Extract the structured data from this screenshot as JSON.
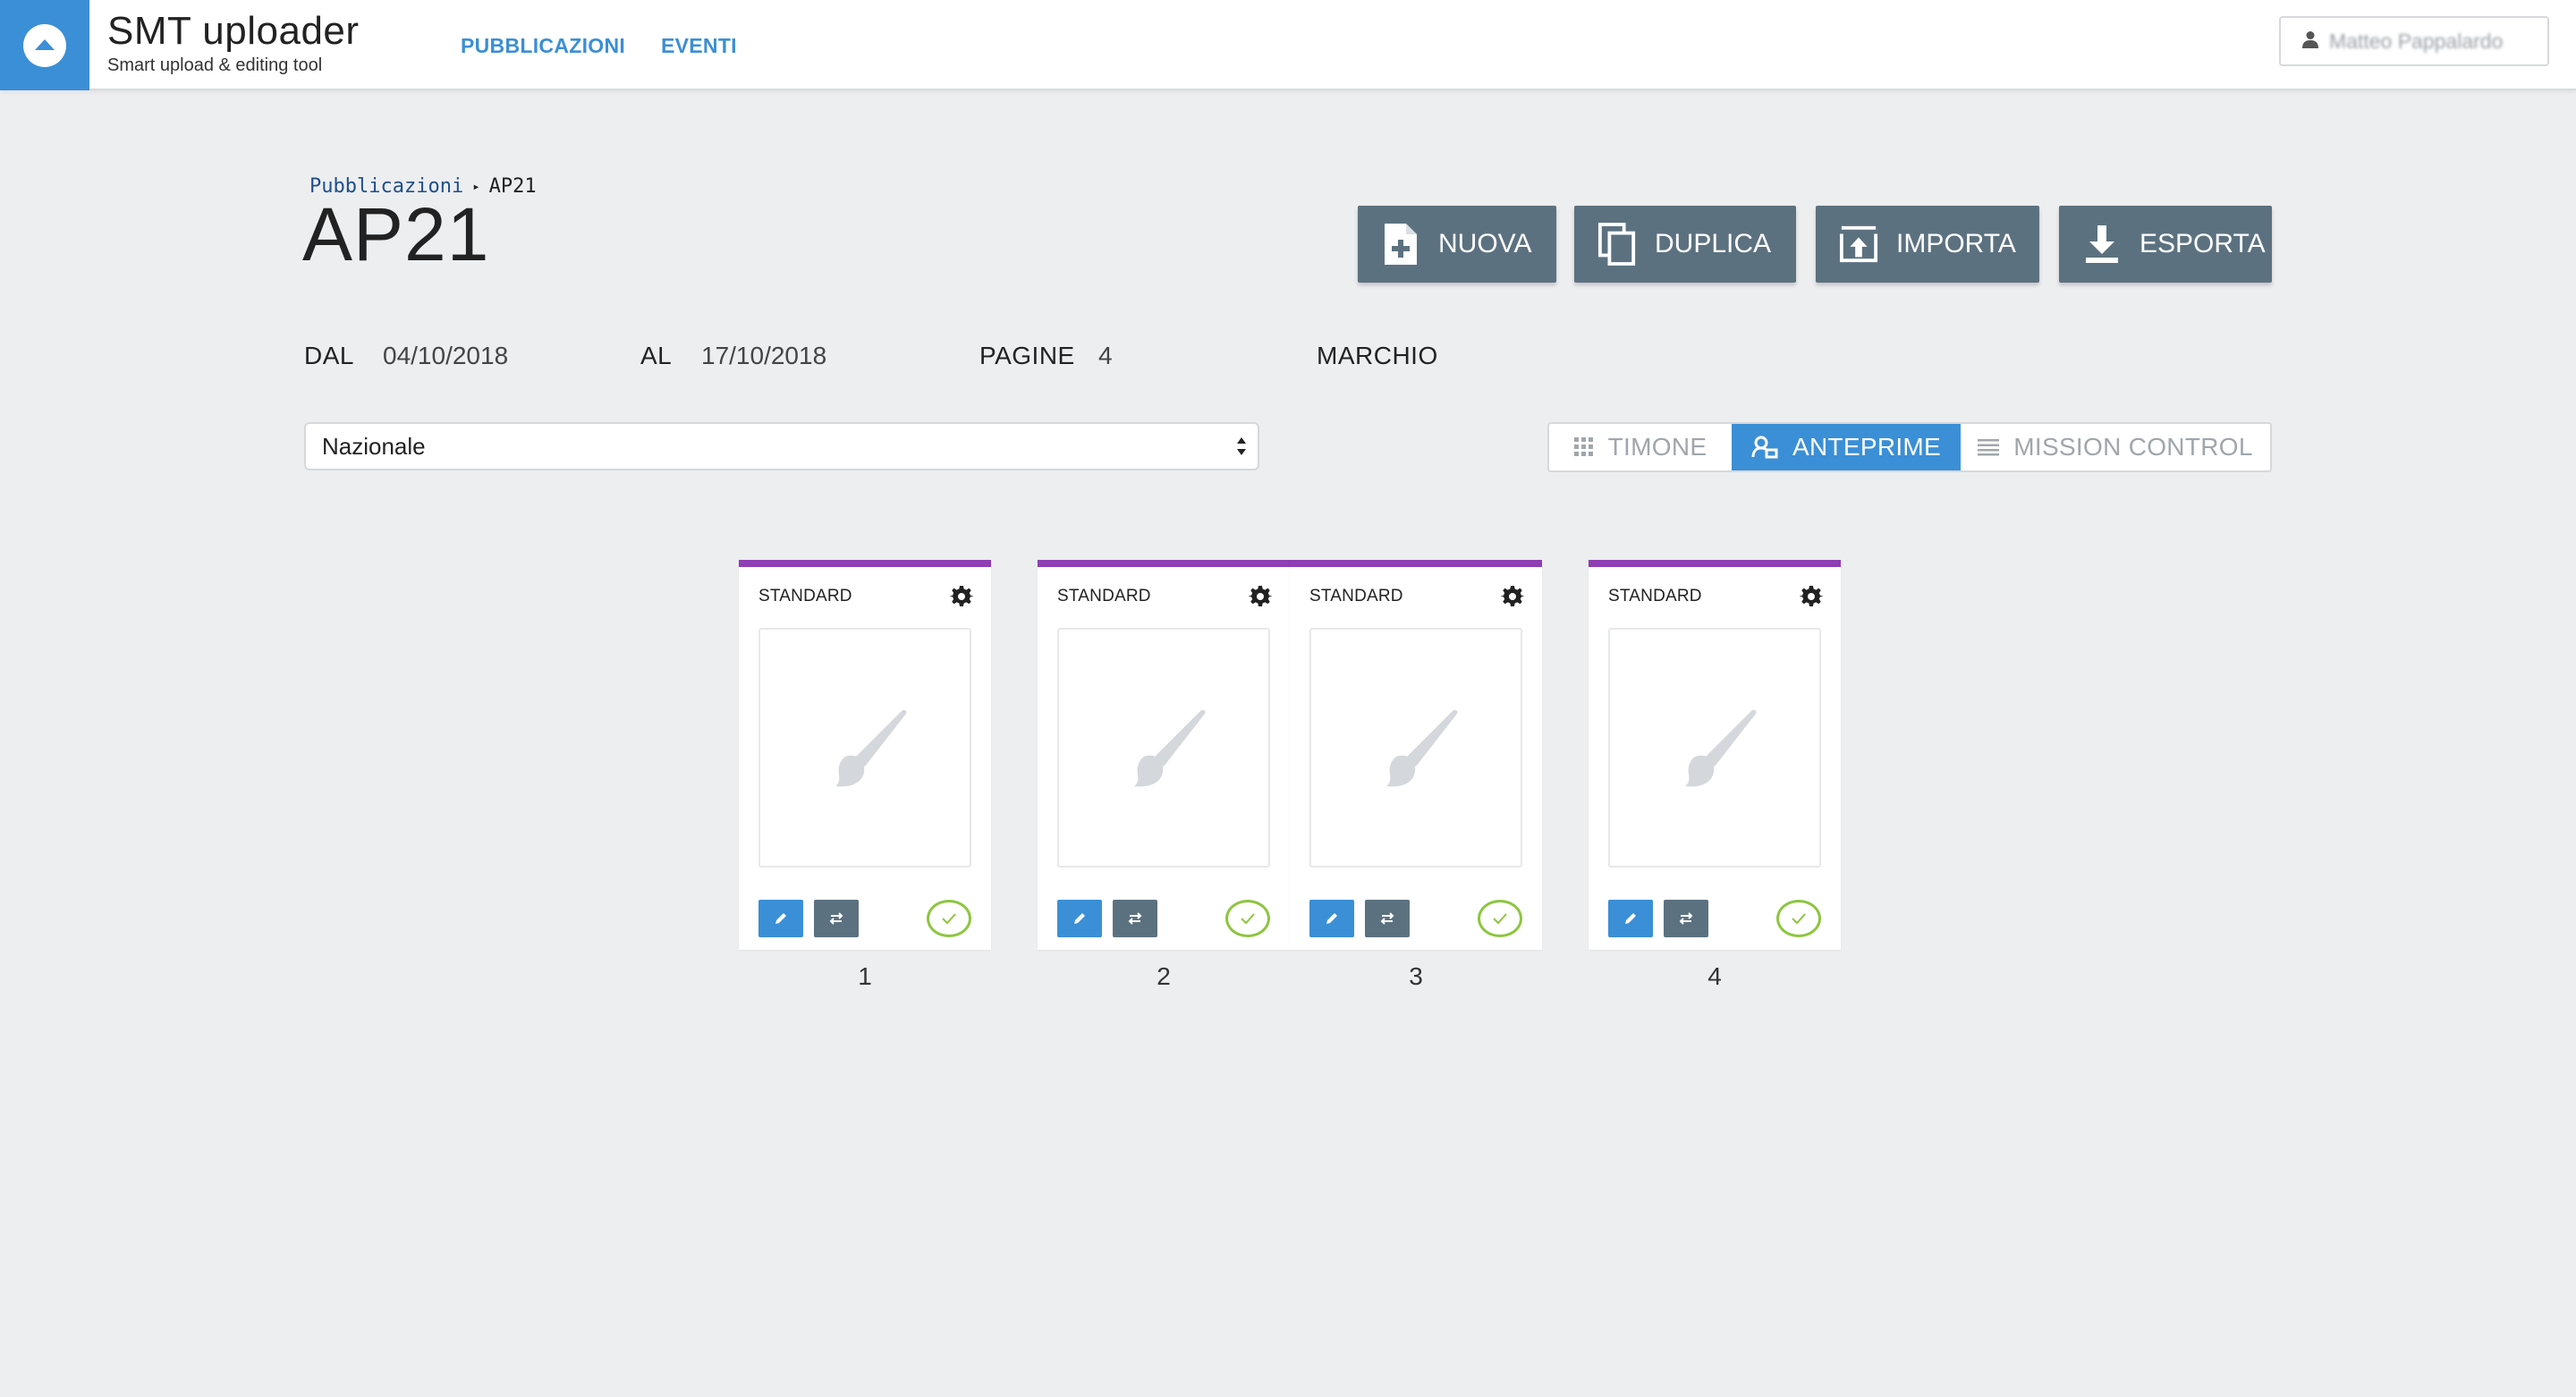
{
  "app": {
    "title": "SMT uploader",
    "subtitle": "Smart upload & editing tool"
  },
  "nav": {
    "publications": "PUBBLICAZIONI",
    "events": "EVENTI"
  },
  "user": {
    "name": "Matteo Pappalardo"
  },
  "breadcrumb": {
    "parent": "Pubblicazioni",
    "current": "AP21"
  },
  "page_title": "AP21",
  "actions": {
    "new": "NUOVA",
    "duplicate": "DUPLICA",
    "import": "IMPORTA",
    "export": "ESPORTA"
  },
  "meta": {
    "from_label": "DAL",
    "from_value": "04/10/2018",
    "to_label": "AL",
    "to_value": "17/10/2018",
    "pages_label": "PAGINE",
    "pages_value": "4",
    "brand_label": "MARCHIO",
    "brand_value": ""
  },
  "edition_select": {
    "selected": "Nazionale"
  },
  "views": {
    "timone": "TIMONE",
    "anteprime": "ANTEPRIME",
    "mission_control": "MISSION CONTROL",
    "active": "anteprime"
  },
  "pages": [
    {
      "number": "1",
      "type": "STANDARD",
      "approved": true
    },
    {
      "number": "2",
      "type": "STANDARD",
      "approved": true
    },
    {
      "number": "3",
      "type": "STANDARD",
      "approved": true
    },
    {
      "number": "4",
      "type": "STANDARD",
      "approved": true
    }
  ],
  "colors": {
    "accent": "#3b8fd6",
    "button_dark": "#5c7180",
    "card_stripe": "#8e3fb3",
    "approved": "#8dc63f",
    "background": "#edeef0"
  }
}
